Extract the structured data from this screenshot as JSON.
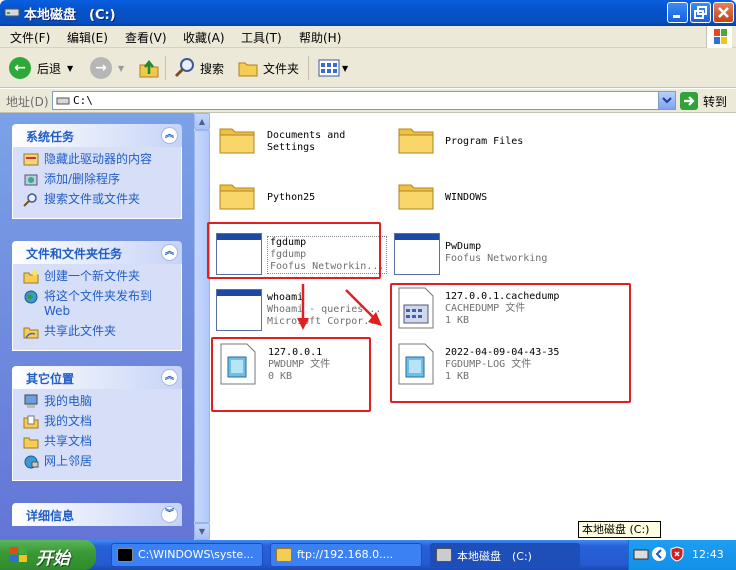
{
  "window": {
    "title": "本地磁盘　(C:)"
  },
  "menu": [
    "文件(F)",
    "编辑(E)",
    "查看(V)",
    "收藏(A)",
    "工具(T)",
    "帮助(H)"
  ],
  "toolbar": {
    "back": "后退",
    "search": "搜索",
    "folders": "文件夹"
  },
  "address": {
    "label": "地址(D)",
    "value": "C:\\",
    "go": "转到"
  },
  "panels": [
    {
      "title": "系统任务",
      "items": [
        "隐藏此驱动器的内容",
        "添加/删除程序",
        "搜索文件或文件夹"
      ]
    },
    {
      "title": "文件和文件夹任务",
      "items": [
        "创建一个新文件夹",
        "将这个文件夹发布到 Web",
        "共享此文件夹"
      ]
    },
    {
      "title": "其它位置",
      "items": [
        "我的电脑",
        "我的文档",
        "共享文档",
        "网上邻居"
      ]
    },
    {
      "title": "详细信息",
      "items": []
    }
  ],
  "files": [
    {
      "name": "Documents and",
      "name2": "Settings",
      "kind": "folder"
    },
    {
      "name": "Program Files",
      "kind": "folder"
    },
    {
      "name": "Python25",
      "kind": "folder"
    },
    {
      "name": "WINDOWS",
      "kind": "folder"
    },
    {
      "name": "fgdump",
      "line2": "fgdump",
      "line3": "Foofus Networkin...",
      "kind": "exe"
    },
    {
      "name": "PwDump",
      "line2": "Foofus Networking",
      "kind": "exe"
    },
    {
      "name": "whoami",
      "line2": "Whoami - queries...",
      "line3": "Microsoft Corpor...",
      "kind": "exe"
    },
    {
      "name": "127.0.0.1.cachedump",
      "line2": "CACHEDUMP 文件",
      "line3": "1 KB",
      "kind": "doc"
    },
    {
      "name": "127.0.0.1",
      "line2": "PWDUMP 文件",
      "line3": "0 KB",
      "kind": "doc"
    },
    {
      "name": "2022-04-09-04-43-35",
      "line2": "FGDUMP-LOG 文件",
      "line3": "1 KB",
      "kind": "doc"
    }
  ],
  "tooltip": "本地磁盘 (C:)",
  "taskbar": {
    "start": "开始",
    "tasks": [
      "C:\\WINDOWS\\syste...",
      "ftp://192.168.0....",
      "本地磁盘　(C:)"
    ],
    "clock": "12:43"
  }
}
